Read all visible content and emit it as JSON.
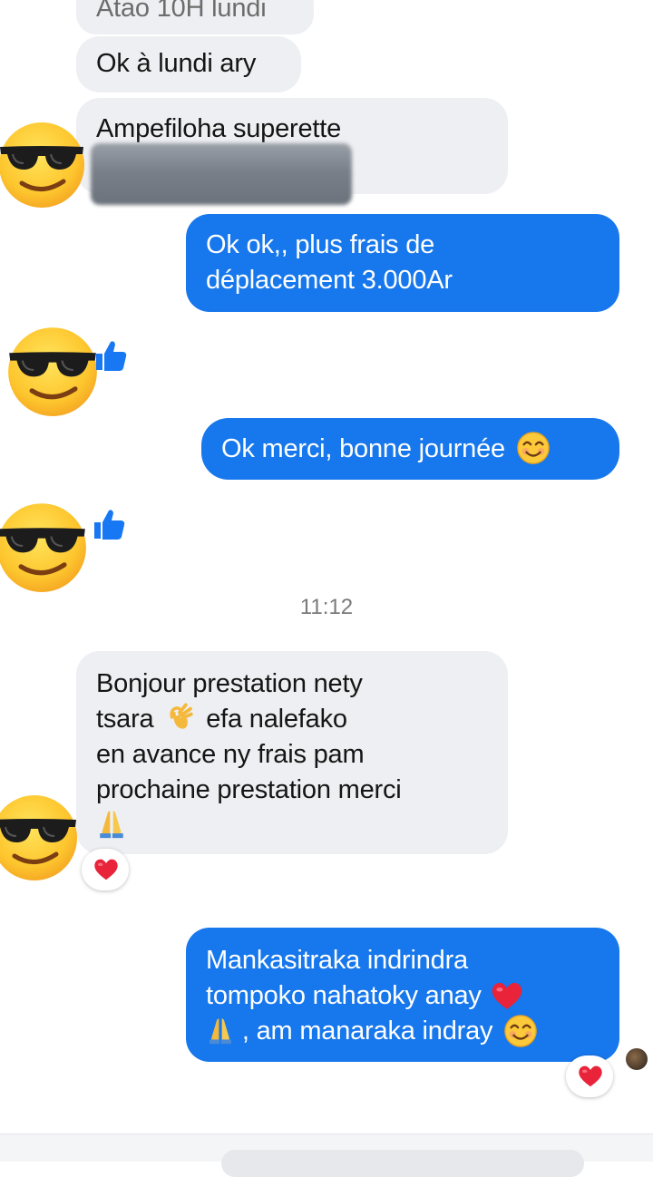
{
  "conversation": {
    "top_partial": "Atao 10H lundi",
    "msg_ok_lundi": "Ok à lundi ary",
    "msg_ampefiloha": "Ampefiloha superette",
    "reply_plus_frais": [
      "Ok ok,, plus frais de",
      "déplacement 3.000Ar"
    ],
    "reply_merci": "Ok merci, bonne journée",
    "timestamp": "11:12",
    "msg_bonjour": [
      "Bonjour prestation nety",
      "tsara",
      "efa nalefako",
      "en avance ny frais pam",
      "prochaine prestation merci"
    ],
    "reply_mankasitraka": [
      "Mankasitraka indrindra",
      "tompoko nahatoky anay",
      ", am manaraka indray"
    ]
  },
  "icons": {
    "avatar": "sunglasses-emoji",
    "like": "thumbs-up-icon",
    "smile": "smiling-face-emoji",
    "ok_hand": "ok-hand-emoji",
    "pray": "folded-hands-emoji",
    "heart": "red-heart-emoji"
  },
  "colors": {
    "outgoing_bubble": "#1777ec",
    "incoming_bubble": "#eeeff2",
    "like_blue": "#1877f2",
    "heart_red": "#e8233a"
  }
}
